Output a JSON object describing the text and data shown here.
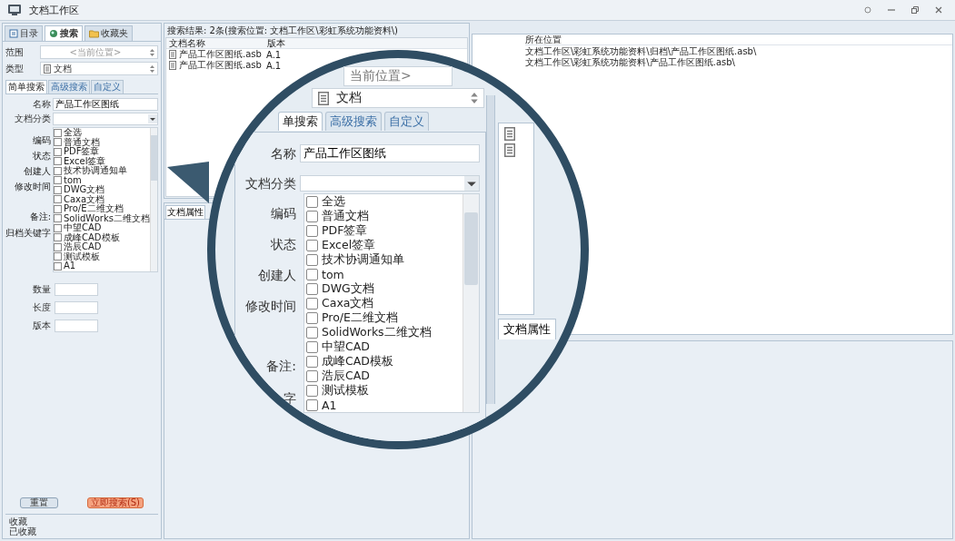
{
  "window": {
    "title": "文档工作区"
  },
  "left_panel": {
    "tabs": [
      {
        "label": "目录",
        "selected": false
      },
      {
        "label": "搜索",
        "selected": true
      },
      {
        "label": "收藏夹",
        "selected": false
      }
    ],
    "scope": {
      "label": "范围",
      "value": "<当前位置>"
    },
    "type": {
      "label": "类型",
      "value": "文档"
    },
    "search_tabs": [
      {
        "label": "简单搜索",
        "selected": true
      },
      {
        "label": "高级搜索",
        "selected": false
      },
      {
        "label": "自定义",
        "selected": false
      }
    ],
    "name_field": {
      "label": "名称",
      "value": "产品工作区图纸"
    },
    "category": {
      "label": "文档分类",
      "options": [
        {
          "label": "全选",
          "checked": false
        },
        {
          "label": "普通文档",
          "checked": false
        },
        {
          "label": "PDF签章",
          "checked": false
        },
        {
          "label": "Excel签章",
          "checked": false
        },
        {
          "label": "技术协调通知单",
          "checked": false
        },
        {
          "label": "tom",
          "checked": false
        },
        {
          "label": "DWG文档",
          "checked": false
        },
        {
          "label": "Caxa文档",
          "checked": false
        },
        {
          "label": "Pro/E二维文档",
          "checked": false
        },
        {
          "label": "SolidWorks二维文档",
          "checked": false
        },
        {
          "label": "中望CAD",
          "checked": false
        },
        {
          "label": "成峰CAD模板",
          "checked": false
        },
        {
          "label": "浩辰CAD",
          "checked": false
        },
        {
          "label": "测试模板",
          "checked": false
        },
        {
          "label": "A1",
          "checked": false
        }
      ]
    },
    "side_labels": [
      "编码",
      "状态",
      "创建人",
      "修改时间",
      "备注:",
      "归档关键字"
    ],
    "fields": [
      {
        "label": "数量"
      },
      {
        "label": "长度"
      },
      {
        "label": "版本"
      }
    ],
    "buttons": [
      {
        "label": "重置",
        "kind": "normal"
      },
      {
        "label": "立即搜索(S)",
        "kind": "primary"
      }
    ],
    "favorites": [
      "收藏",
      "已收藏"
    ]
  },
  "results": {
    "title": "搜索结果: 2条(搜索位置: 文档工作区\\彩虹系统功能资料\\)",
    "columns": [
      "文档名称",
      "版本"
    ],
    "rows": [
      {
        "name": "产品工作区图纸.asb",
        "version": "A.1"
      },
      {
        "name": "产品工作区图纸.asb",
        "version": "A.1"
      }
    ]
  },
  "properties_tabs": [
    {
      "label": "文档属性",
      "selected": true
    }
  ],
  "locations": {
    "column": "所在位置",
    "rows": [
      "文档工作区\\彩虹系统功能资料\\归档\\产品工作区图纸.asb\\",
      "文档工作区\\彩虹系统功能资料\\产品工作区图纸.asb\\"
    ]
  },
  "magnifier": {
    "scope_value": "当前位置>",
    "type_value": "文档",
    "tabs": [
      {
        "label": "单搜索",
        "selected": true
      },
      {
        "label": "高级搜索",
        "selected": false
      },
      {
        "label": "自定义",
        "selected": false
      }
    ],
    "name_label": "名称",
    "name_value": "产品工作区图纸",
    "category_label": "文档分类",
    "options": [
      {
        "label": "全选",
        "checked": false
      },
      {
        "label": "普通文档",
        "checked": false
      },
      {
        "label": "PDF签章",
        "checked": false
      },
      {
        "label": "Excel签章",
        "checked": false
      },
      {
        "label": "技术协调通知单",
        "checked": false
      },
      {
        "label": "tom",
        "checked": false
      },
      {
        "label": "DWG文档",
        "checked": false
      },
      {
        "label": "Caxa文档",
        "checked": false
      },
      {
        "label": "Pro/E二维文档",
        "checked": false
      },
      {
        "label": "SolidWorks二维文档",
        "checked": false
      },
      {
        "label": "中望CAD",
        "checked": false
      },
      {
        "label": "成峰CAD模板",
        "checked": false
      },
      {
        "label": "浩辰CAD",
        "checked": false
      },
      {
        "label": "测试模板",
        "checked": false
      },
      {
        "label": "A1",
        "checked": false
      }
    ],
    "side_labels": [
      "编码",
      "状态",
      "创建人",
      "修改时间",
      "备注:",
      "字"
    ],
    "right_tab": "文档属性"
  }
}
